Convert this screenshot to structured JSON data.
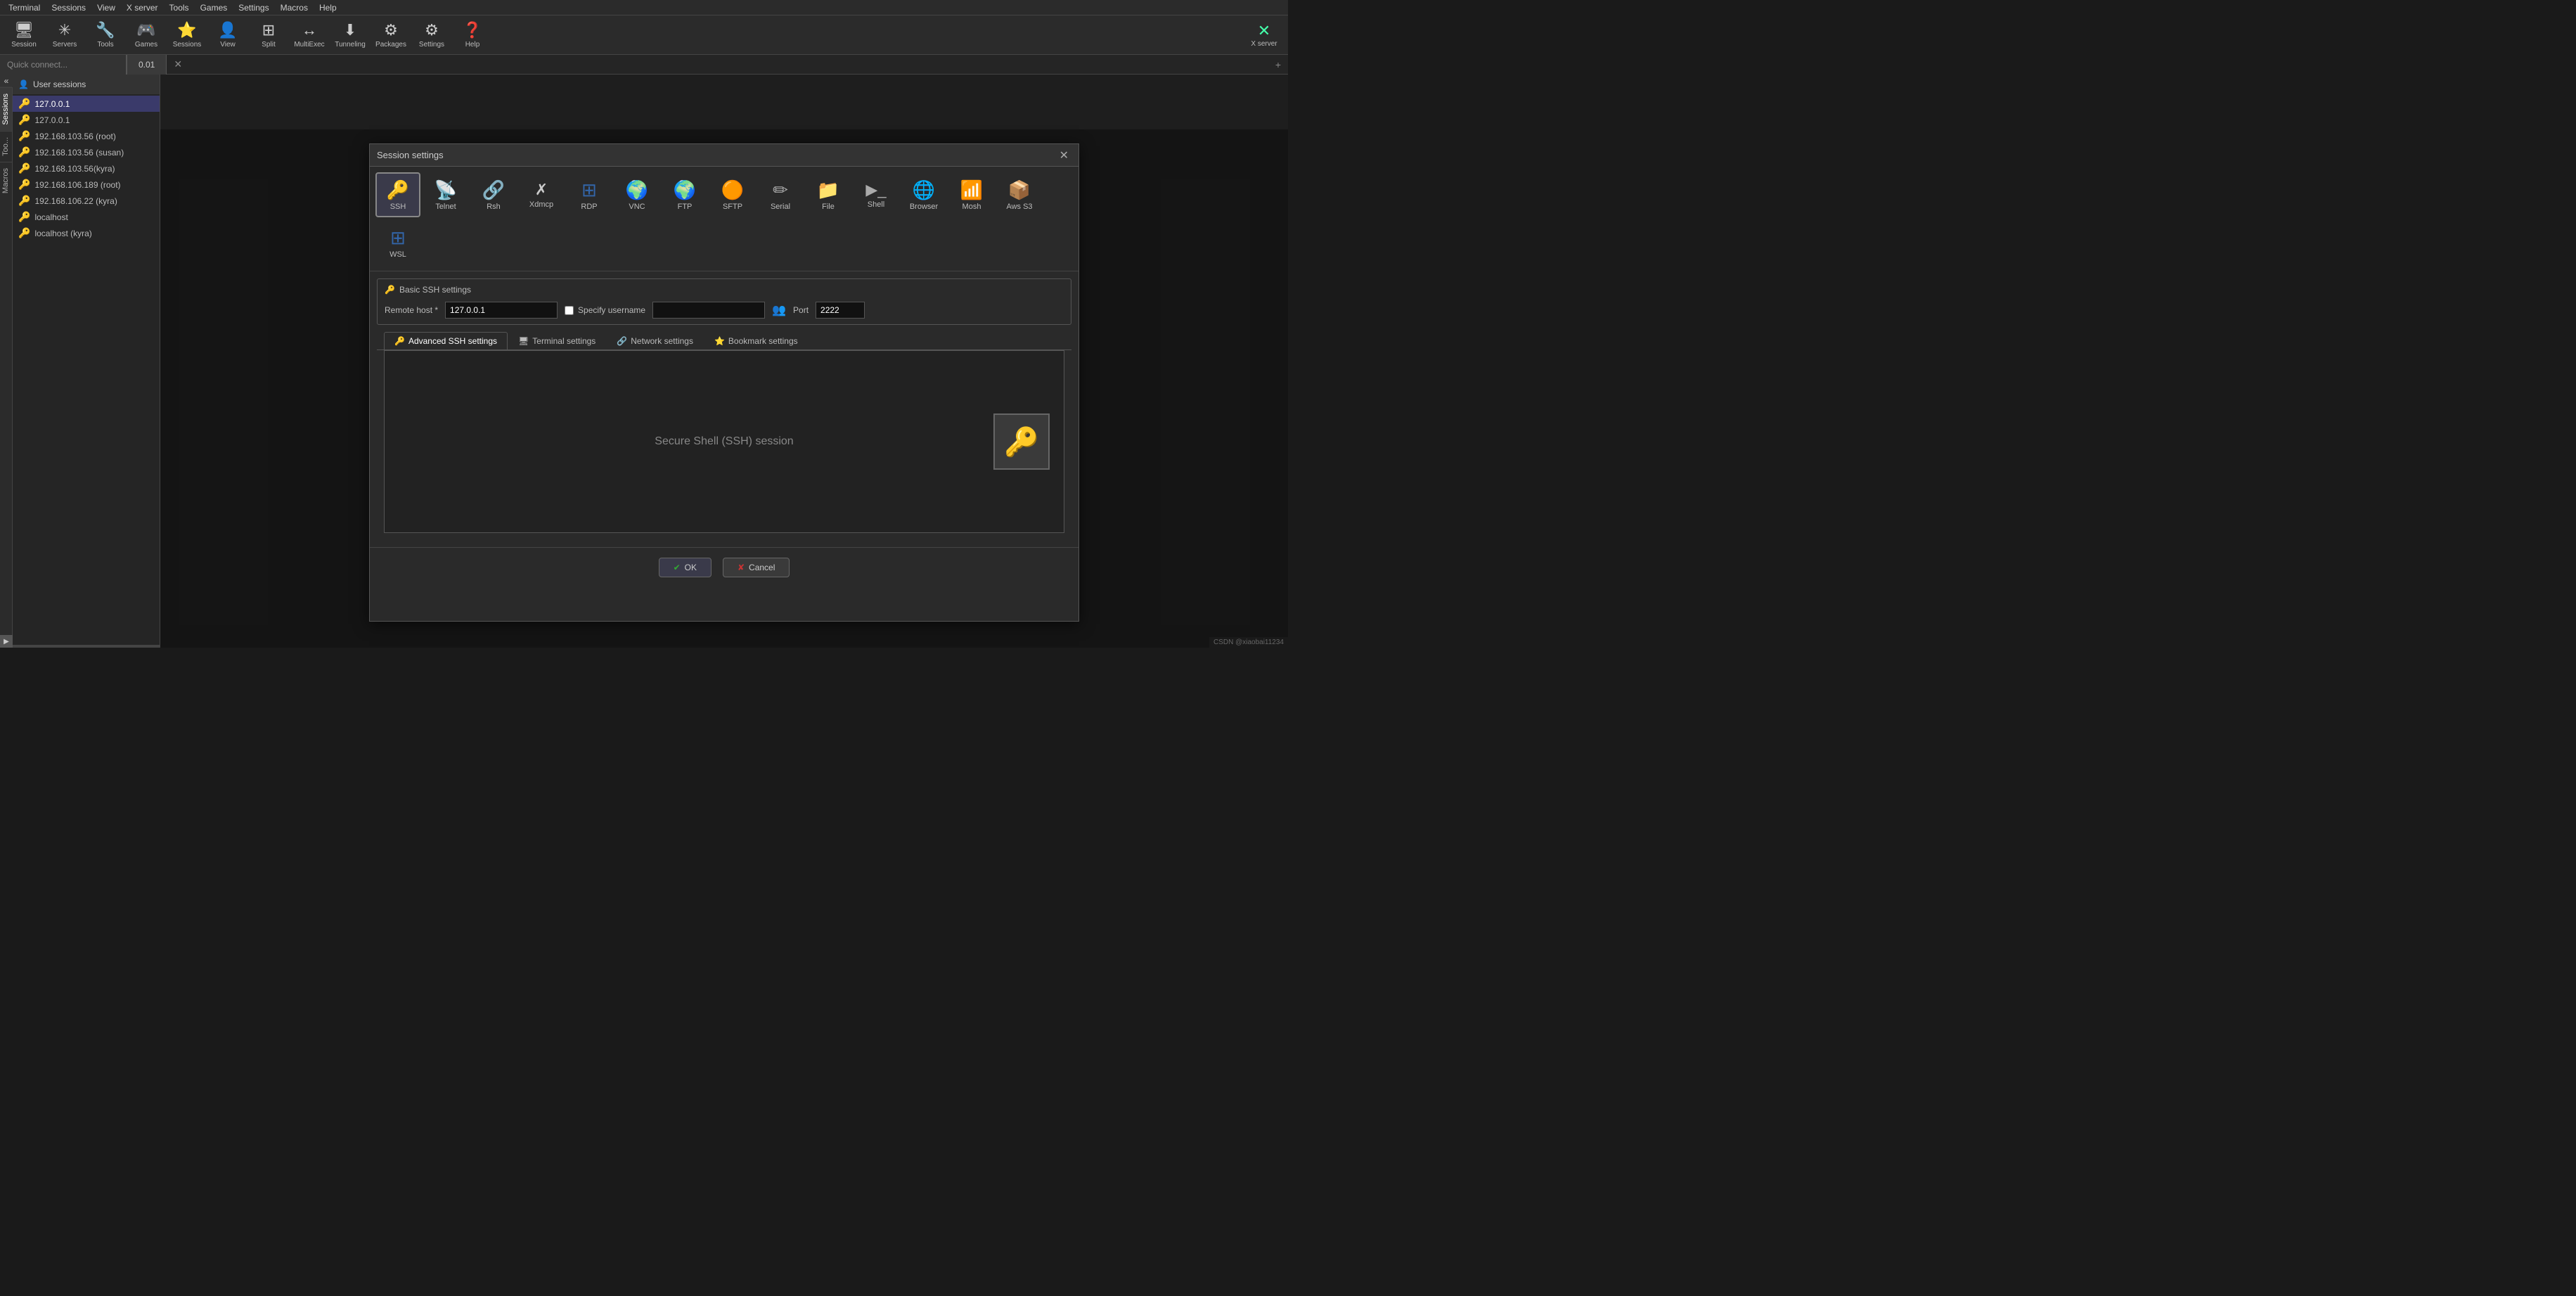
{
  "menubar": {
    "items": [
      "Terminal",
      "Sessions",
      "View",
      "X server",
      "Tools",
      "Games",
      "Settings",
      "Macros",
      "Help"
    ]
  },
  "toolbar": {
    "buttons": [
      {
        "id": "session",
        "label": "Session",
        "icon": "🖥"
      },
      {
        "id": "servers",
        "label": "Servers",
        "icon": "✳"
      },
      {
        "id": "tools",
        "label": "Tools",
        "icon": "🔧"
      },
      {
        "id": "games",
        "label": "Games",
        "icon": "🎮"
      },
      {
        "id": "sessions",
        "label": "Sessions",
        "icon": "⭐"
      },
      {
        "id": "view",
        "label": "View",
        "icon": "👤"
      },
      {
        "id": "split",
        "label": "Split",
        "icon": "⊞"
      },
      {
        "id": "multiexec",
        "label": "MultiExec",
        "icon": "↔"
      },
      {
        "id": "tunneling",
        "label": "Tunneling",
        "icon": "⬇"
      },
      {
        "id": "packages",
        "label": "Packages",
        "icon": "⚙"
      },
      {
        "id": "settings",
        "label": "Settings",
        "icon": "❓"
      },
      {
        "id": "help",
        "label": "Help",
        "icon": "❓"
      }
    ],
    "xserver_label": "X server"
  },
  "quickconnect": {
    "placeholder": "Quick connect..."
  },
  "tab_bar": {
    "active_tab": "0.01",
    "new_tab": "+"
  },
  "vsidebar": {
    "tabs": [
      "Sessions",
      "Too...",
      "Macros"
    ]
  },
  "session_panel": {
    "header": "User sessions",
    "items": [
      {
        "label": "127.0.0.1",
        "active": true
      },
      {
        "label": "127.0.0.1"
      },
      {
        "label": "192.168.103.56 (root)"
      },
      {
        "label": "192.168.103.56 (susan)"
      },
      {
        "label": "192.168.103.56(kyra)"
      },
      {
        "label": "192.168.106.189 (root)"
      },
      {
        "label": "192.168.106.22 (kyra)"
      },
      {
        "label": "localhost"
      },
      {
        "label": "localhost (kyra)"
      }
    ]
  },
  "dialog": {
    "title": "Session settings",
    "proto_tabs": [
      {
        "id": "ssh",
        "label": "SSH",
        "icon": "🔑",
        "active": true
      },
      {
        "id": "telnet",
        "label": "Telnet",
        "icon": "📡"
      },
      {
        "id": "rsh",
        "label": "Rsh",
        "icon": "🔗"
      },
      {
        "id": "xdmcp",
        "label": "Xdmcp",
        "icon": "✗"
      },
      {
        "id": "rdp",
        "label": "RDP",
        "icon": "⊞"
      },
      {
        "id": "vnc",
        "label": "VNC",
        "icon": "🔵"
      },
      {
        "id": "ftp",
        "label": "FTP",
        "icon": "🌍"
      },
      {
        "id": "sftp",
        "label": "SFTP",
        "icon": "🟠"
      },
      {
        "id": "serial",
        "label": "Serial",
        "icon": "✏"
      },
      {
        "id": "file",
        "label": "File",
        "icon": "📁"
      },
      {
        "id": "shell",
        "label": "Shell",
        "icon": "▶"
      },
      {
        "id": "browser",
        "label": "Browser",
        "icon": "🌐"
      },
      {
        "id": "mosh",
        "label": "Mosh",
        "icon": "📶"
      },
      {
        "id": "awss3",
        "label": "Aws S3",
        "icon": "📦"
      },
      {
        "id": "wsl",
        "label": "WSL",
        "icon": "⊞"
      }
    ],
    "basic_ssh": {
      "section_label": "Basic SSH settings",
      "remote_host_label": "Remote host *",
      "remote_host_value": "127.0.0.1",
      "specify_username_label": "Specify username",
      "specify_username_checked": false,
      "username_value": "",
      "port_label": "Port",
      "port_value": "2222"
    },
    "sub_tabs": [
      {
        "id": "advanced_ssh",
        "label": "Advanced SSH settings",
        "icon": "🔑"
      },
      {
        "id": "terminal",
        "label": "Terminal settings",
        "icon": "🖥"
      },
      {
        "id": "network",
        "label": "Network settings",
        "icon": "🔗"
      },
      {
        "id": "bookmark",
        "label": "Bookmark settings",
        "icon": "⭐"
      }
    ],
    "content": {
      "session_text": "Secure Shell (SSH) session",
      "key_icon": "🔑"
    },
    "buttons": {
      "ok_label": "OK",
      "cancel_label": "Cancel"
    }
  },
  "statusbar": {
    "text": "CSDN @xiaobai11234"
  }
}
